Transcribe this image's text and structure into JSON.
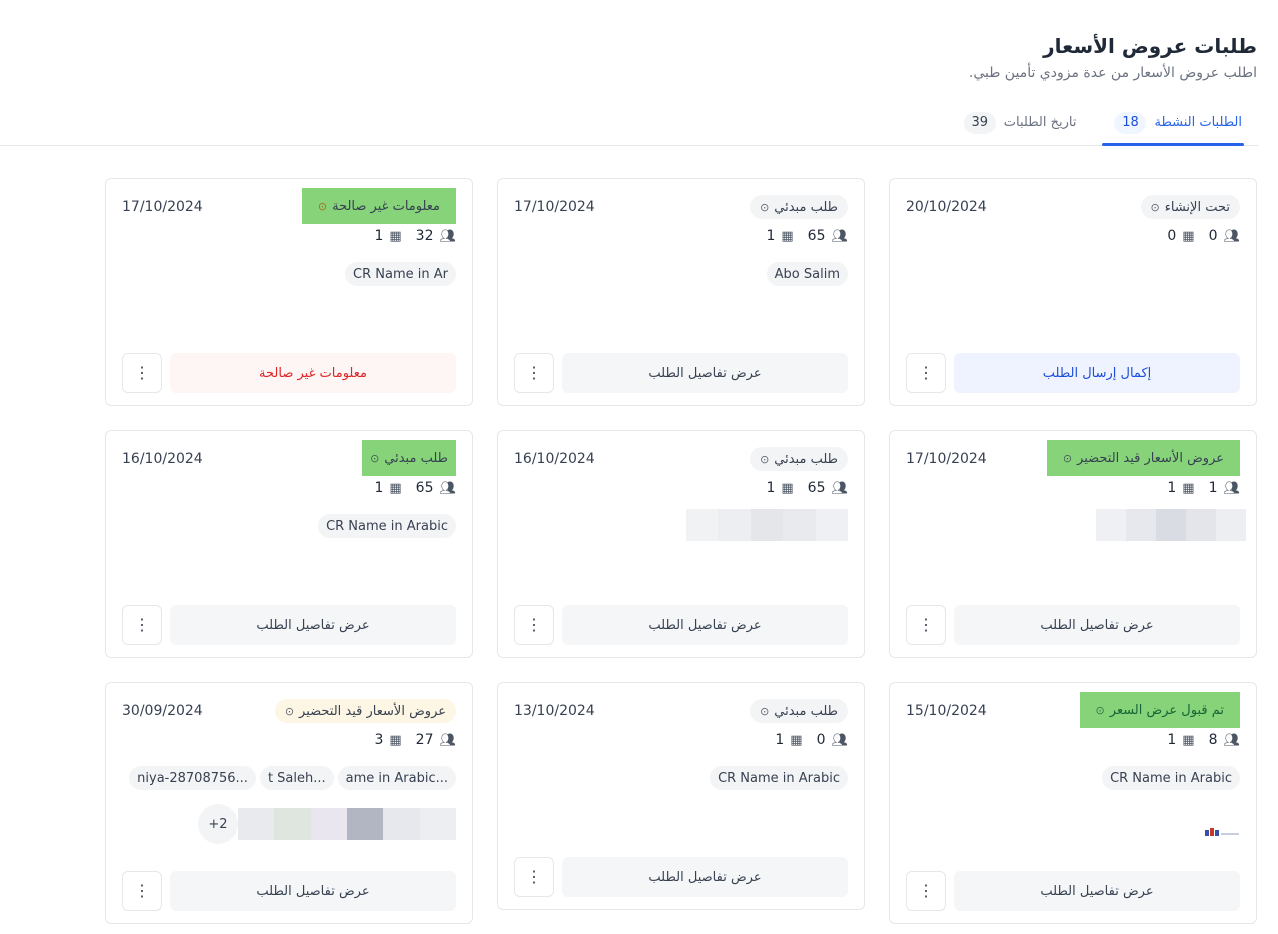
{
  "header": {
    "title": "طلبات عروض الأسعار",
    "subtitle": "اطلب عروض الأسعار من عدة مزودي تأمين طبي."
  },
  "tabs": [
    {
      "label": "الطلبات النشطة",
      "count": "18",
      "active": true
    },
    {
      "label": "تاريخ الطلبات",
      "count": "39",
      "active": false
    }
  ],
  "cards": [
    {
      "status": "تحت الإنشاء",
      "date": "20/10/2024",
      "members": "0",
      "branches": "0",
      "chips": [],
      "action": "إكمال إرسال الطلب"
    },
    {
      "status": "طلب مبدئي",
      "date": "17/10/2024",
      "members": "65",
      "branches": "1",
      "chips": [
        "Abo Salim"
      ],
      "action": "عرض تفاصيل الطلب"
    },
    {
      "status": "معلومات غير صالحة",
      "date": "17/10/2024",
      "members": "32",
      "branches": "1",
      "chips": [
        "CR Name in Ar"
      ],
      "action": "معلومات غير صالحة"
    },
    {
      "status": "عروض الأسعار قيد التحضير",
      "date": "17/10/2024",
      "members": "1",
      "branches": "1",
      "chips": [],
      "action": "عرض تفاصيل الطلب"
    },
    {
      "status": "طلب مبدئي",
      "date": "16/10/2024",
      "members": "65",
      "branches": "1",
      "chips": [],
      "action": "عرض تفاصيل الطلب"
    },
    {
      "status": "طلب مبدئي",
      "date": "16/10/2024",
      "members": "65",
      "branches": "1",
      "chips": [
        "CR Name in Arabic"
      ],
      "action": "عرض تفاصيل الطلب"
    },
    {
      "status": "تم قبول عرض السعر",
      "date": "15/10/2024",
      "members": "8",
      "branches": "1",
      "chips": [
        "CR Name in Arabic"
      ],
      "action": "عرض تفاصيل الطلب"
    },
    {
      "status": "طلب مبدئي",
      "date": "13/10/2024",
      "members": "0",
      "branches": "1",
      "chips": [
        "CR Name in Arabic"
      ],
      "action": "عرض تفاصيل الطلب"
    },
    {
      "status": "عروض الأسعار قيد التحضير",
      "date": "30/09/2024",
      "members": "27",
      "branches": "3",
      "chips": [
        "ame in Arabic...",
        "t Saleh...",
        "niya-28708756..."
      ],
      "extra_count": "+2",
      "action": "عرض تفاصيل الطلب"
    }
  ],
  "icons": {
    "members": "users-icon",
    "branches": "building-icon",
    "status": "clock-icon",
    "more": "dots-vertical-icon"
  },
  "colors": {
    "accent": "#2563eb",
    "highlight": "#86d37a",
    "danger": "#dc2626"
  }
}
